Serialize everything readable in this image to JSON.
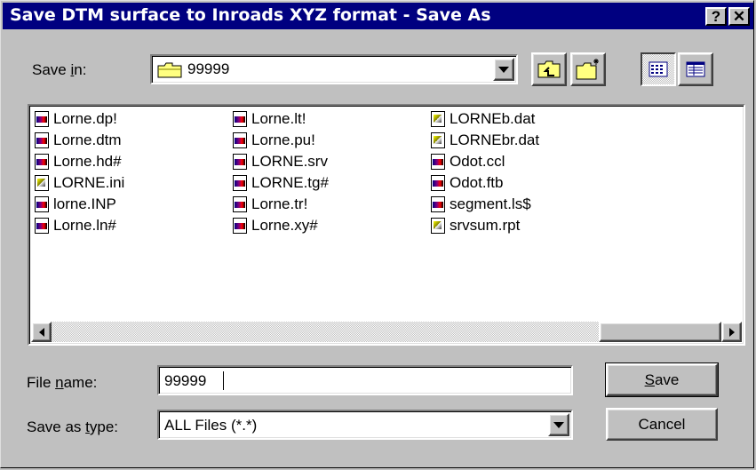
{
  "window": {
    "title": "Save DTM surface to Inroads XYZ format - Save As",
    "help_glyph": "?",
    "close_glyph": "✕"
  },
  "save_in": {
    "label_pre": "Save ",
    "label_accel": "i",
    "label_post": "n:",
    "value": "99999"
  },
  "files": [
    {
      "name": "Lorne.dp!",
      "icon": "app-file-icon"
    },
    {
      "name": "Lorne.dtm",
      "icon": "app-file-icon"
    },
    {
      "name": "Lorne.hd#",
      "icon": "app-file-icon"
    },
    {
      "name": "LORNE.ini",
      "icon": "settings-file-icon"
    },
    {
      "name": "lorne.INP",
      "icon": "app-file-icon"
    },
    {
      "name": "Lorne.ln#",
      "icon": "app-file-icon"
    },
    {
      "name": "Lorne.lt!",
      "icon": "app-file-icon"
    },
    {
      "name": "Lorne.pu!",
      "icon": "app-file-icon"
    },
    {
      "name": "LORNE.srv",
      "icon": "app-file-icon"
    },
    {
      "name": "LORNE.tg#",
      "icon": "app-file-icon"
    },
    {
      "name": "Lorne.tr!",
      "icon": "app-file-icon"
    },
    {
      "name": "Lorne.xy#",
      "icon": "app-file-icon"
    },
    {
      "name": "LORNEb.dat",
      "icon": "settings-file-icon"
    },
    {
      "name": "LORNEbr.dat",
      "icon": "settings-file-icon"
    },
    {
      "name": "Odot.ccl",
      "icon": "app-file-icon"
    },
    {
      "name": "Odot.ftb",
      "icon": "app-file-icon"
    },
    {
      "name": "segment.ls$",
      "icon": "app-file-icon"
    },
    {
      "name": "srvsum.rpt",
      "icon": "settings-file-icon"
    }
  ],
  "file_name": {
    "label_pre": "File ",
    "label_accel": "n",
    "label_post": "ame:",
    "value": "99999"
  },
  "save_as_type": {
    "label_pre": "Save as ",
    "label_accel": "t",
    "label_post": "ype:",
    "value": "ALL Files (*.*)"
  },
  "buttons": {
    "save_accel": "S",
    "save_rest": "ave",
    "cancel": "Cancel"
  }
}
